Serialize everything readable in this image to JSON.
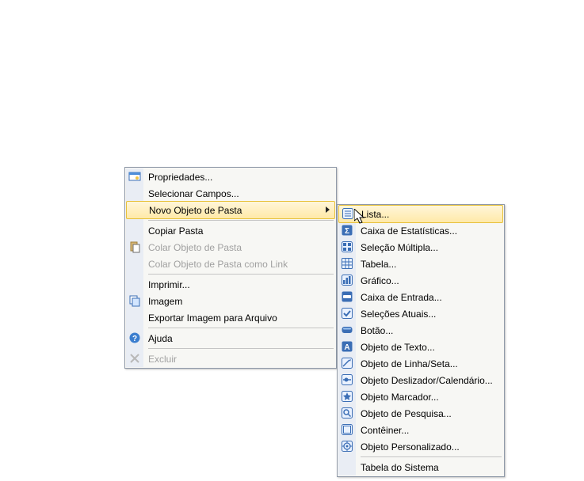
{
  "mainMenu": {
    "items": [
      {
        "label": "Propriedades...",
        "icon": "properties-icon",
        "disabled": false
      },
      {
        "label": "Selecionar Campos...",
        "icon": null,
        "disabled": false
      },
      {
        "label": "Novo Objeto de Pasta",
        "icon": null,
        "disabled": false,
        "submenu": true,
        "highlight": true
      },
      {
        "sep": true
      },
      {
        "label": "Copiar Pasta",
        "icon": null,
        "disabled": false
      },
      {
        "label": "Colar Objeto de Pasta",
        "icon": "paste-icon",
        "disabled": true
      },
      {
        "label": "Colar Objeto de Pasta como Link",
        "icon": null,
        "disabled": true
      },
      {
        "sep": true
      },
      {
        "label": "Imprimir...",
        "icon": null,
        "disabled": false
      },
      {
        "label": "Imagem",
        "icon": "copy-icon",
        "disabled": false
      },
      {
        "label": "Exportar Imagem para Arquivo",
        "icon": null,
        "disabled": false
      },
      {
        "sep": true
      },
      {
        "label": "Ajuda",
        "icon": "help-icon",
        "disabled": false
      },
      {
        "sep": true
      },
      {
        "label": "Excluir",
        "icon": "delete-icon",
        "disabled": true
      }
    ]
  },
  "subMenu": {
    "items": [
      {
        "label": "Lista...",
        "icon": "list-icon",
        "disabled": false,
        "highlight": true
      },
      {
        "label": "Caixa de Estatísticas...",
        "icon": "stats-icon",
        "disabled": false
      },
      {
        "label": "Seleção Múltipla...",
        "icon": "multiselect-icon",
        "disabled": false
      },
      {
        "label": "Tabela...",
        "icon": "table-icon",
        "disabled": false
      },
      {
        "label": "Gráfico...",
        "icon": "chart-icon",
        "disabled": false
      },
      {
        "label": "Caixa de Entrada...",
        "icon": "input-icon",
        "disabled": false
      },
      {
        "label": "Seleções Atuais...",
        "icon": "selections-icon",
        "disabled": false
      },
      {
        "label": "Botão...",
        "icon": "button-icon",
        "disabled": false
      },
      {
        "label": "Objeto de Texto...",
        "icon": "text-icon",
        "disabled": false
      },
      {
        "label": "Objeto de Linha/Seta...",
        "icon": "line-icon",
        "disabled": false
      },
      {
        "label": "Objeto Deslizador/Calendário...",
        "icon": "slider-icon",
        "disabled": false
      },
      {
        "label": "Objeto Marcador...",
        "icon": "bookmark-icon",
        "disabled": false
      },
      {
        "label": "Objeto de Pesquisa...",
        "icon": "search-icon",
        "disabled": false
      },
      {
        "label": "Contêiner...",
        "icon": "container-icon",
        "disabled": false
      },
      {
        "label": "Objeto Personalizado...",
        "icon": "custom-icon",
        "disabled": false
      },
      {
        "sep": true
      },
      {
        "label": "Tabela do Sistema",
        "icon": null,
        "disabled": false
      }
    ]
  }
}
